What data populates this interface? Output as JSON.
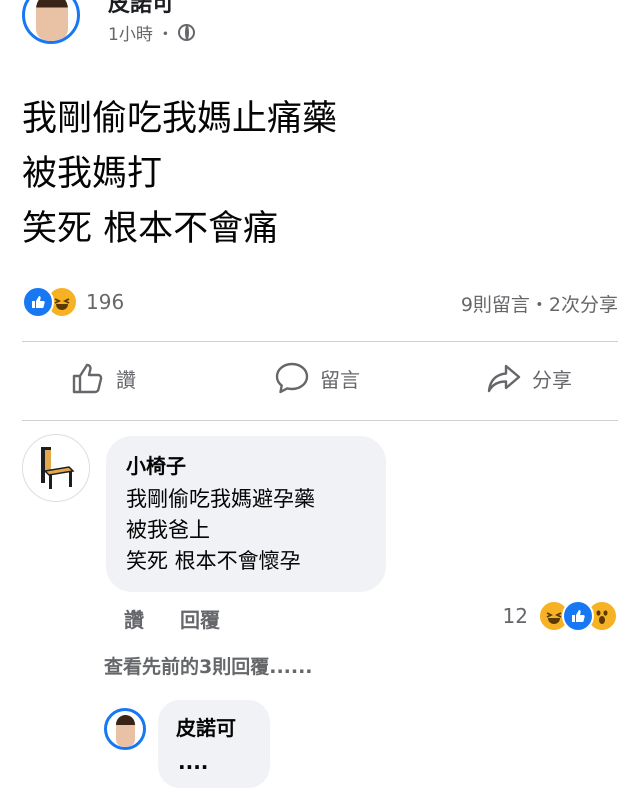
{
  "post": {
    "author": "皮諾可",
    "time": "1小時",
    "separator": "・",
    "privacy_icon": "globe-icon",
    "lines": [
      "我剛偷吃我媽止痛藥",
      "被我媽打",
      "笑死 根本不會痛"
    ],
    "reaction_icons": [
      "like-icon",
      "haha-icon"
    ],
    "reaction_count": "196",
    "counts": "9則留言・2次分享"
  },
  "actions": {
    "like": "讚",
    "comment": "留言",
    "share": "分享"
  },
  "comment": {
    "author": "小椅子",
    "lines": [
      "我剛偷吃我媽避孕藥",
      "被我爸上",
      "笑死 根本不會懷孕"
    ],
    "like_label": "讚",
    "reply_label": "回覆",
    "reaction_count": "12",
    "reaction_icons": [
      "haha-icon",
      "like-icon",
      "wow-icon"
    ]
  },
  "view_more": "查看先前的3則回覆......",
  "reply": {
    "author": "皮諾可",
    "text": "...."
  },
  "colors": {
    "accent": "#1877f2",
    "muted": "#65676b",
    "bubble": "#f0f2f5",
    "emoji": "#f7b125"
  }
}
